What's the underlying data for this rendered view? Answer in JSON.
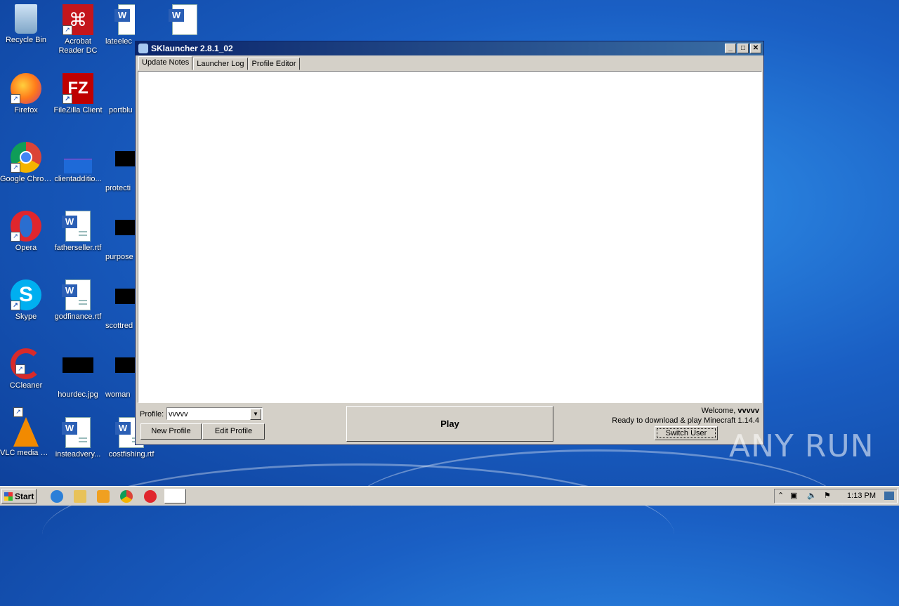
{
  "desktop": {
    "icons": [
      {
        "label": "Recycle Bin"
      },
      {
        "label": "Acrobat Reader DC"
      },
      {
        "label": "lateelec"
      },
      {
        "label": ""
      },
      {
        "label": "Firefox"
      },
      {
        "label": "FileZilla Client"
      },
      {
        "label": "portblu"
      },
      {
        "label": "Google Chrome"
      },
      {
        "label": "clientadditio..."
      },
      {
        "label": "protecti"
      },
      {
        "label": "Opera"
      },
      {
        "label": "fatherseller.rtf"
      },
      {
        "label": "purpose"
      },
      {
        "label": "Skype"
      },
      {
        "label": "godfinance.rtf"
      },
      {
        "label": "scottred"
      },
      {
        "label": "CCleaner"
      },
      {
        "label": "hourdec.jpg"
      },
      {
        "label": "woman"
      },
      {
        "label": "VLC media player"
      },
      {
        "label": "insteadvery..."
      },
      {
        "label": "costfishing.rtf"
      }
    ]
  },
  "window": {
    "title": "SKlauncher 2.8.1_02",
    "tabs": [
      {
        "label": "Update Notes"
      },
      {
        "label": "Launcher Log"
      },
      {
        "label": "Profile Editor"
      }
    ],
    "profile_label": "Profile:",
    "profile_value": "vvvvv",
    "new_profile": "New Profile",
    "edit_profile": "Edit Profile",
    "play": "Play",
    "welcome_prefix": "Welcome, ",
    "welcome_user": "vvvvv",
    "status": "Ready to download & play Minecraft 1.14.4",
    "switch_user": "Switch User"
  },
  "taskbar": {
    "start": "Start",
    "clock": "1:13 PM"
  },
  "watermark": "ANY RUN"
}
